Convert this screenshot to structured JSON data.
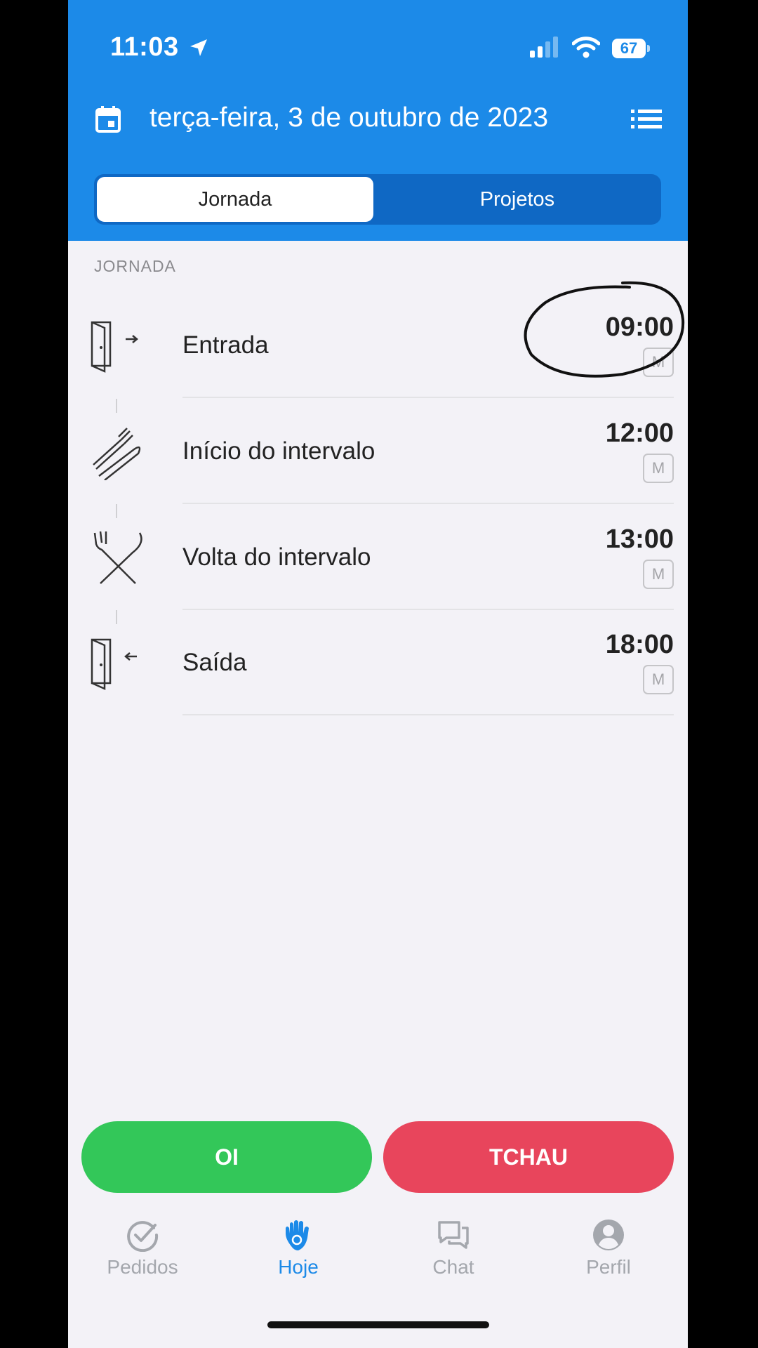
{
  "status_bar": {
    "time": "11:03",
    "battery": "67"
  },
  "header": {
    "title": "terça-feira, 3 de outubro de 2023"
  },
  "tabs": {
    "active": "Jornada",
    "inactive": "Projetos"
  },
  "section": {
    "label": "JORNADA"
  },
  "entries": [
    {
      "label": "Entrada",
      "time": "09:00",
      "badge": "M"
    },
    {
      "label": "Início do intervalo",
      "time": "12:00",
      "badge": "M"
    },
    {
      "label": "Volta do intervalo",
      "time": "13:00",
      "badge": "M"
    },
    {
      "label": "Saída",
      "time": "18:00",
      "badge": "M"
    }
  ],
  "actions": {
    "oi": "OI",
    "tchau": "TCHAU"
  },
  "tabbar": [
    {
      "label": "Pedidos"
    },
    {
      "label": "Hoje"
    },
    {
      "label": "Chat"
    },
    {
      "label": "Perfil"
    }
  ],
  "colors": {
    "primary": "#1c8ae8",
    "green": "#33c759",
    "red": "#e8455c",
    "background": "#f3f2f7"
  }
}
